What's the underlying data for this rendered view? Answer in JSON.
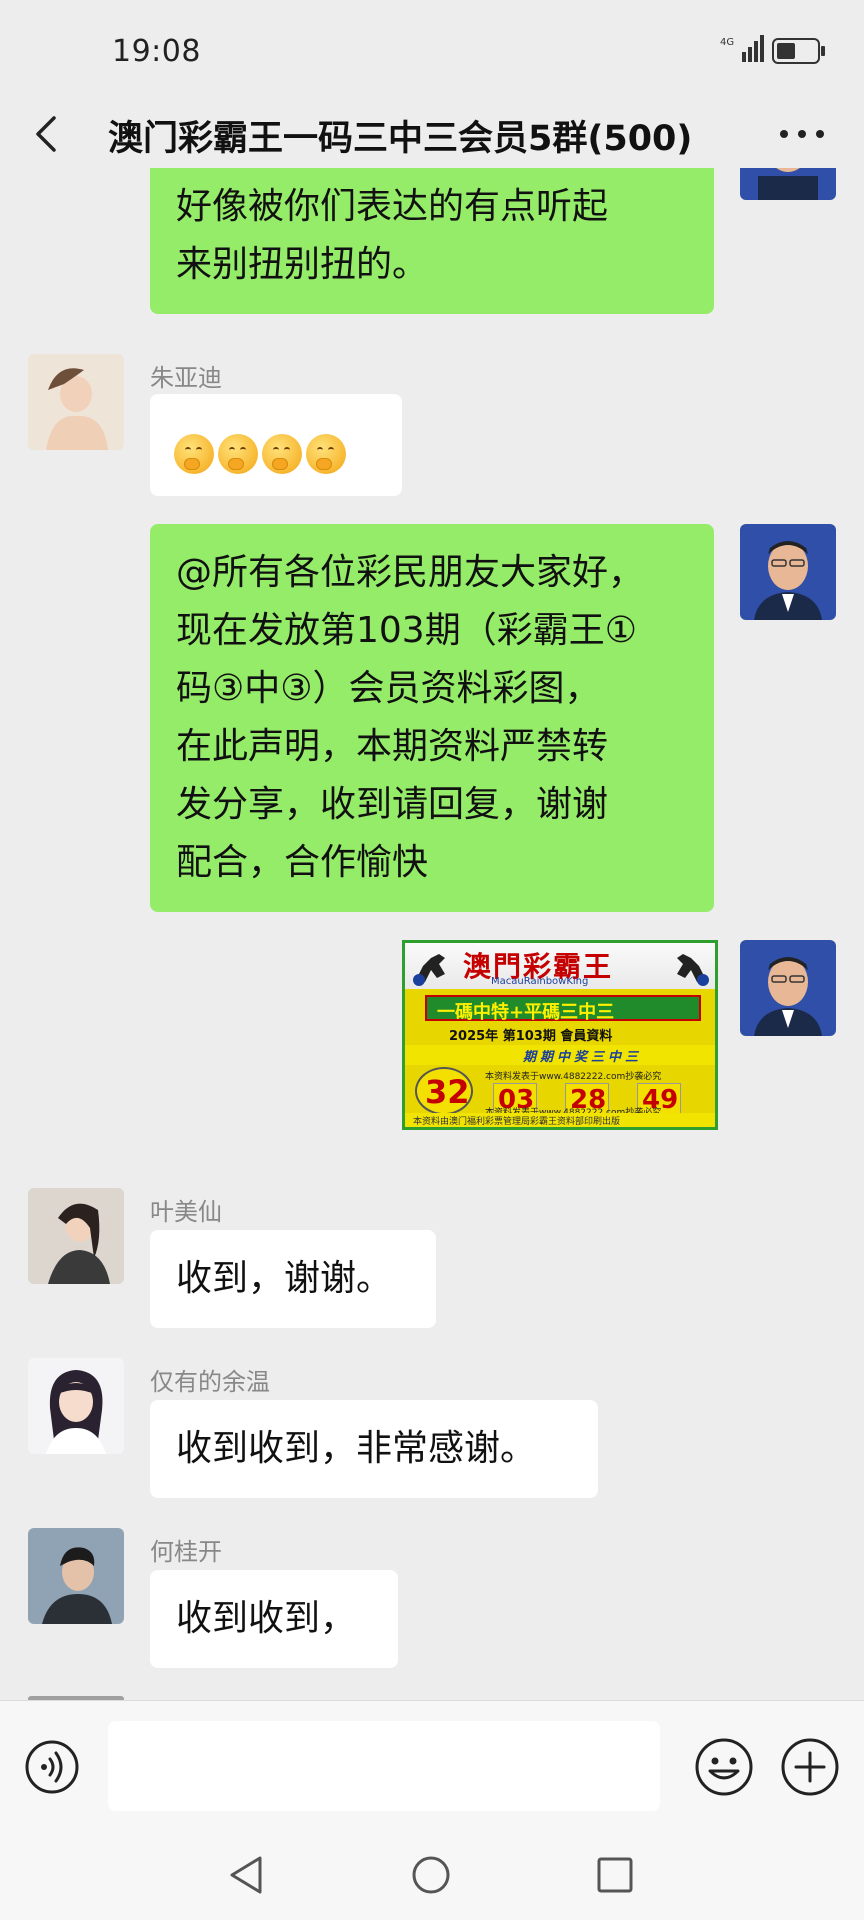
{
  "status": {
    "time": "19:08",
    "network": "4G"
  },
  "header": {
    "title": "澳门彩霸王一码三中三会员5群(500)"
  },
  "messages": [
    {
      "side": "right",
      "lines": [
        "好像被你们表达的有点听起",
        "来别扭别扭的。"
      ]
    },
    {
      "side": "left",
      "sender": "朱亚迪",
      "content": "emoji",
      "emoji_count": 4
    },
    {
      "side": "right",
      "lines": [
        "@所有各位彩民朋友大家好，",
        "现在发放第103期（彩霸王①",
        "码③中③）会员资料彩图，",
        "在此声明，本期资料严禁转",
        "发分享，收到请回复，谢谢",
        "配合，合作愉快"
      ]
    },
    {
      "side": "right",
      "content": "image",
      "image": {
        "title": "澳門彩霸王",
        "subtitle": "MacauRainbowKing",
        "band": "一碼中特+平碼三中三",
        "issue": "2025年  第103期  會員資料",
        "slogan": "期期中奖三中三",
        "special_number": "32",
        "numbers": [
          "03",
          "28",
          "49"
        ],
        "url_line_1": "本资料发表于www.4882222.com抄袭必究",
        "url_line_2": "本资料发表于www.4882222.com抄袭必究",
        "footer": "本资料由澳门福利彩票管理局彩霸王资料部印刷出版"
      }
    },
    {
      "side": "left",
      "sender": "叶美仙",
      "text": "收到，谢谢。"
    },
    {
      "side": "left",
      "sender": "仅有的余温",
      "text": "收到收到，非常感谢。"
    },
    {
      "side": "left",
      "sender": "何桂开",
      "text": "收到收到，"
    }
  ],
  "icons": {
    "back": "back-arrow-icon",
    "more": "more-dots-icon",
    "voice": "voice-icon",
    "emoji": "emoji-icon",
    "plus": "plus-icon"
  },
  "colors": {
    "green_bubble": "#95ec69",
    "white_bubble": "#ffffff",
    "background": "#ededed"
  }
}
